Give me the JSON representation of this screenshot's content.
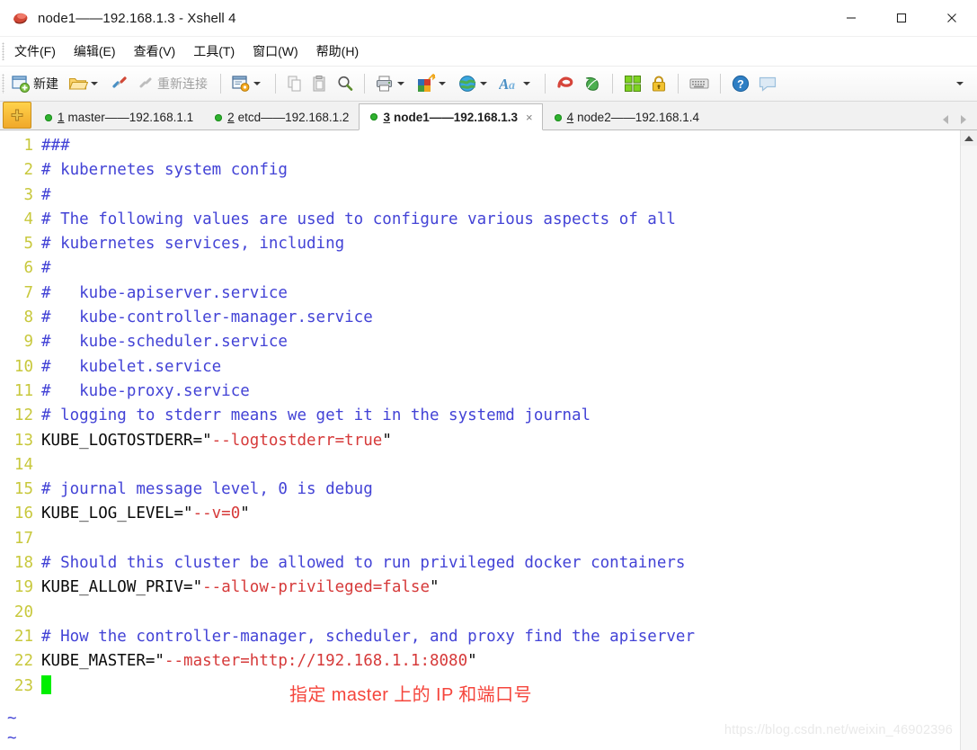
{
  "window": {
    "title": "node1——192.168.1.3 - Xshell 4",
    "app_icon": "xshell-logo-icon",
    "minimize_label": "—",
    "maximize_label": "□",
    "close_label": "✕"
  },
  "menubar": {
    "items": [
      {
        "label": "文件(F)",
        "name": "menu-file"
      },
      {
        "label": "编辑(E)",
        "name": "menu-edit"
      },
      {
        "label": "查看(V)",
        "name": "menu-view"
      },
      {
        "label": "工具(T)",
        "name": "menu-tools"
      },
      {
        "label": "窗口(W)",
        "name": "menu-window"
      },
      {
        "label": "帮助(H)",
        "name": "menu-help"
      }
    ]
  },
  "toolbar": {
    "new_label": "新建",
    "reconnect_label": "重新连接",
    "overflow_label": "▾"
  },
  "tabs": {
    "add_label": "+",
    "items": [
      {
        "num": "1",
        "title": "master——192.168.1.1",
        "active": false,
        "status": "connected"
      },
      {
        "num": "2",
        "title": "etcd——192.168.1.2",
        "active": false,
        "status": "connected"
      },
      {
        "num": "3",
        "title": "node1——192.168.1.3",
        "active": true,
        "status": "connected",
        "close_label": "×"
      },
      {
        "num": "4",
        "title": "node2——192.168.1.4",
        "active": false,
        "status": "connected"
      }
    ]
  },
  "terminal": {
    "lines": [
      {
        "n": "1",
        "parts": [
          {
            "t": "###",
            "c": "comment"
          }
        ]
      },
      {
        "n": "2",
        "parts": [
          {
            "t": "# kubernetes system config",
            "c": "comment"
          }
        ]
      },
      {
        "n": "3",
        "parts": [
          {
            "t": "#",
            "c": "comment"
          }
        ]
      },
      {
        "n": "4",
        "parts": [
          {
            "t": "# The following values are used to configure various aspects of all",
            "c": "comment"
          }
        ]
      },
      {
        "n": "5",
        "parts": [
          {
            "t": "# kubernetes services, including",
            "c": "comment"
          }
        ]
      },
      {
        "n": "6",
        "parts": [
          {
            "t": "#",
            "c": "comment"
          }
        ]
      },
      {
        "n": "7",
        "parts": [
          {
            "t": "#   kube-apiserver.service",
            "c": "comment"
          }
        ]
      },
      {
        "n": "8",
        "parts": [
          {
            "t": "#   kube-controller-manager.service",
            "c": "comment"
          }
        ]
      },
      {
        "n": "9",
        "parts": [
          {
            "t": "#   kube-scheduler.service",
            "c": "comment"
          }
        ]
      },
      {
        "n": "10",
        "parts": [
          {
            "t": "#   kubelet.service",
            "c": "comment"
          }
        ]
      },
      {
        "n": "11",
        "parts": [
          {
            "t": "#   kube-proxy.service",
            "c": "comment"
          }
        ]
      },
      {
        "n": "12",
        "parts": [
          {
            "t": "# logging to stderr means we get it in the systemd journal",
            "c": "comment"
          }
        ]
      },
      {
        "n": "13",
        "parts": [
          {
            "t": "KUBE_LOGTOSTDERR=\"",
            "c": "plain"
          },
          {
            "t": "--logtostderr=true",
            "c": "string"
          },
          {
            "t": "\"",
            "c": "plain"
          }
        ]
      },
      {
        "n": "14",
        "parts": []
      },
      {
        "n": "15",
        "parts": [
          {
            "t": "# journal message level, 0 is debug",
            "c": "comment"
          }
        ]
      },
      {
        "n": "16",
        "parts": [
          {
            "t": "KUBE_LOG_LEVEL=\"",
            "c": "plain"
          },
          {
            "t": "--v=0",
            "c": "string"
          },
          {
            "t": "\"",
            "c": "plain"
          }
        ]
      },
      {
        "n": "17",
        "parts": []
      },
      {
        "n": "18",
        "parts": [
          {
            "t": "# Should this cluster be allowed to run privileged docker containers",
            "c": "comment"
          }
        ]
      },
      {
        "n": "19",
        "parts": [
          {
            "t": "KUBE_ALLOW_PRIV=\"",
            "c": "plain"
          },
          {
            "t": "--allow-privileged=false",
            "c": "string"
          },
          {
            "t": "\"",
            "c": "plain"
          }
        ]
      },
      {
        "n": "20",
        "parts": []
      },
      {
        "n": "21",
        "parts": [
          {
            "t": "# How the controller-manager, scheduler, and proxy find the apiserver",
            "c": "comment"
          }
        ]
      },
      {
        "n": "22",
        "parts": [
          {
            "t": "KUBE_MASTER=\"",
            "c": "plain"
          },
          {
            "t": "--master=http://192.168.1.1:8080",
            "c": "string"
          },
          {
            "t": "\"",
            "c": "plain"
          }
        ]
      },
      {
        "n": "23",
        "parts": [],
        "cursor": true
      }
    ],
    "empty_markers": [
      "~",
      "~"
    ],
    "annotation": "指定 master 上的 IP 和端口号",
    "watermark": "https://blog.csdn.net/weixin_46902396"
  },
  "colors": {
    "line_number": "#c8c83c",
    "comment": "#4343d6",
    "string": "#d63a3a",
    "plain": "#0a0a0a",
    "cursor": "#00ef00",
    "annotation": "#f5453c",
    "tab_status_dot": "#2fb22f"
  }
}
